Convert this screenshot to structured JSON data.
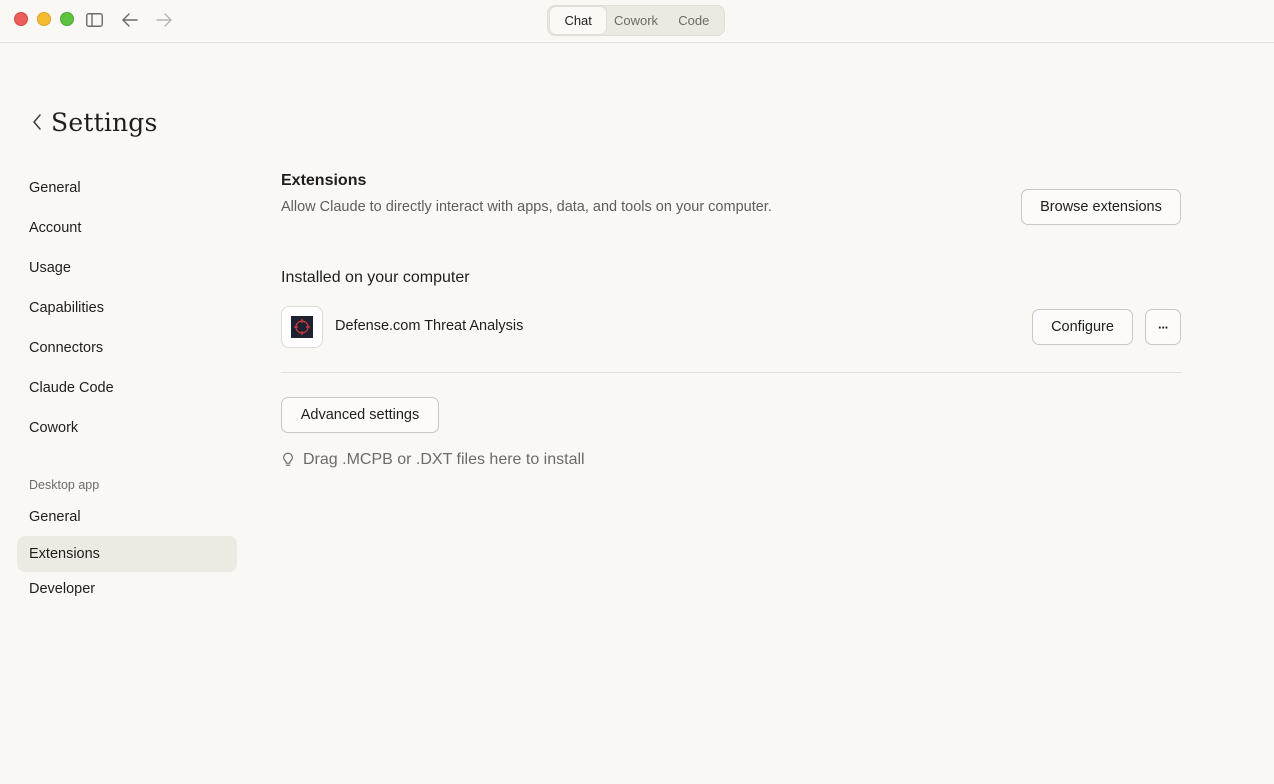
{
  "titlebar": {
    "tabs": [
      {
        "label": "Chat",
        "active": true
      },
      {
        "label": "Cowork",
        "active": false
      },
      {
        "label": "Code",
        "active": false
      }
    ],
    "icons": [
      "sidebar-toggle-icon",
      "arrow-left-icon",
      "arrow-right-icon"
    ]
  },
  "settings": {
    "title": "Settings"
  },
  "sidebar": {
    "items": [
      {
        "label": "General"
      },
      {
        "label": "Account"
      },
      {
        "label": "Usage"
      },
      {
        "label": "Capabilities"
      },
      {
        "label": "Connectors"
      },
      {
        "label": "Claude Code"
      },
      {
        "label": "Cowork"
      }
    ],
    "desktop_section_label": "Desktop app",
    "desktop_items": [
      {
        "label": "General",
        "active": false
      },
      {
        "label": "Extensions",
        "active": true
      },
      {
        "label": "Developer",
        "active": false
      }
    ]
  },
  "main": {
    "title": "Extensions",
    "subtitle": "Allow Claude to directly interact with apps, data, and tools on your computer.",
    "browse_label": "Browse extensions",
    "installed_title": "Installed on your computer",
    "installed": [
      {
        "name": "Defense.com Threat Analysis",
        "configure_label": "Configure",
        "more_label": "···"
      }
    ],
    "advanced_label": "Advanced settings",
    "drag_hint": "Drag .MCPB or .DXT files here to install"
  },
  "colors": {
    "background": "#f9f8f5",
    "active_item": "#ecebe3",
    "close": "#ec5f58",
    "minimize": "#f3bd2f",
    "zoom": "#5fc23f",
    "extension_icon_bg": "#1e2230",
    "extension_icon_accent": "#d8393a"
  }
}
